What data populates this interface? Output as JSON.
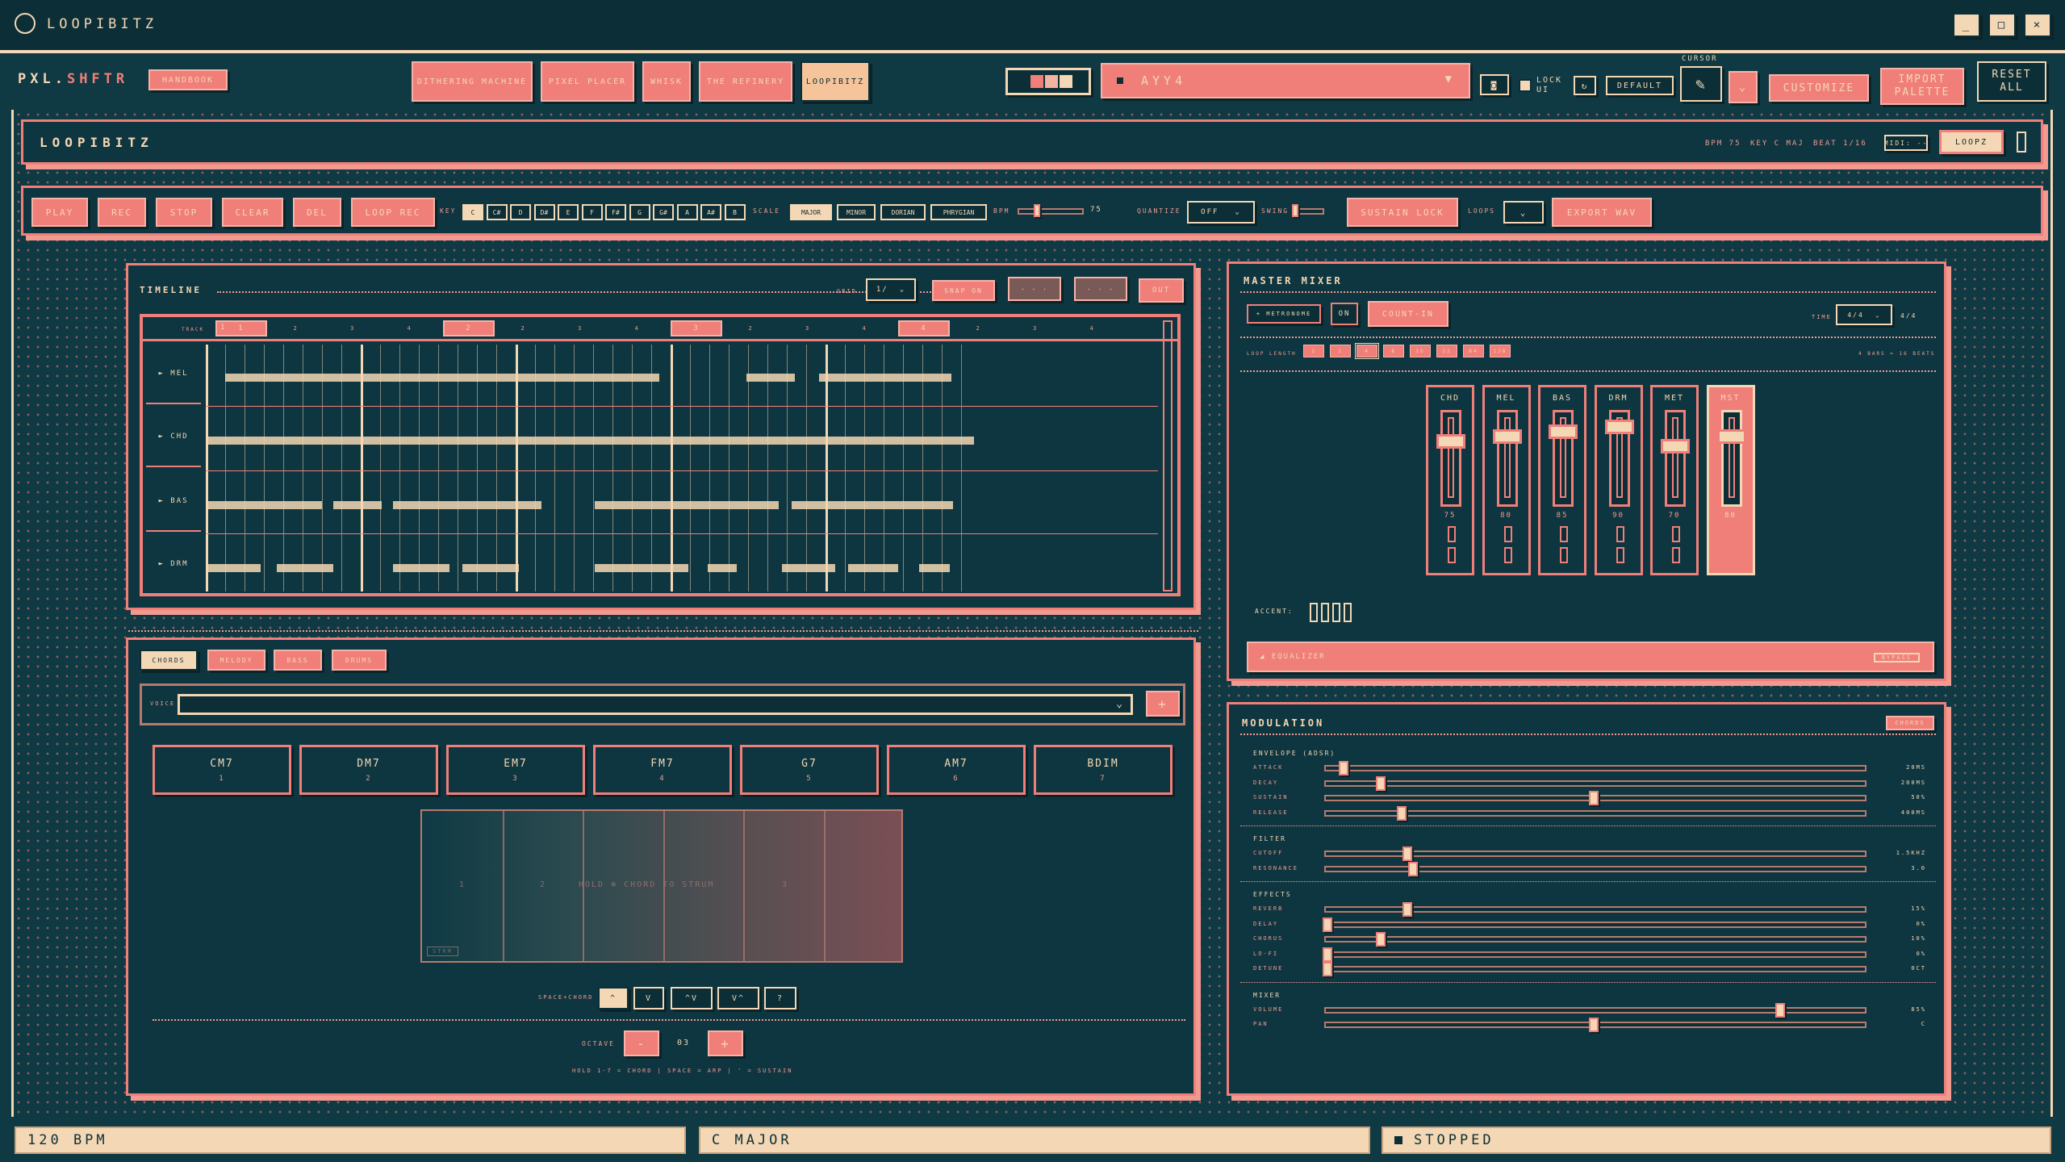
{
  "window": {
    "title": "LOOPIBITZ",
    "min_icon": "minimize-icon",
    "max_icon": "maximize-icon",
    "close_icon": "close-icon"
  },
  "topbar": {
    "brand_a": "PXL.",
    "brand_b": "SHFTR",
    "handbook": "HANDBOOK",
    "tabs": [
      "DITHERING MACHINE",
      "PIXEL PLACER",
      "WHISK",
      "THE REFINERY",
      "LOOPIBITZ"
    ],
    "palette_name": "AYY4",
    "lock_label": "LOCK UI",
    "default": "DEFAULT",
    "cursor_label": "CURSOR",
    "customize": "CUSTOMIZE",
    "import_palette": "IMPORT PALETTE",
    "reset_all": "RESET ALL"
  },
  "header": {
    "title": "LOOPIBITZ",
    "bpm": "BPM 75",
    "key": "KEY C MAJ",
    "beat": "BEAT 1/16",
    "midi": "MIDI: --",
    "loopz": "LOOPZ"
  },
  "transport": {
    "buttons": [
      "PLAY",
      "REC",
      "STOP",
      "CLEAR",
      "DEL",
      "LOOP REC"
    ],
    "key_label": "KEY",
    "keys": [
      "C",
      "C#",
      "D",
      "D#",
      "E",
      "F",
      "F#",
      "G",
      "G#",
      "A",
      "A#",
      "B"
    ],
    "scale_label": "SCALE",
    "scales": [
      "MAJOR",
      "MINOR",
      "DORIAN",
      "PHRYGIAN"
    ],
    "bpm_label": "BPM",
    "bpm_value": "75",
    "quantize_label": "QUANTIZE",
    "quantize_value": "OFF",
    "swing_label": "SWING",
    "sustain_lock": "SUSTAIN LOCK",
    "loops_label": "LOOPS",
    "export": "EXPORT WAV"
  },
  "timeline": {
    "title": "TIMELINE",
    "grid_label": "GRID",
    "grid_value": "1/",
    "snap": "SNAP ON",
    "out": "OUT",
    "track_label": "TRACK",
    "bars": [
      "1",
      "2",
      "3",
      "4"
    ],
    "rows": [
      "► MEL",
      "► CHD",
      "► BAS",
      "► DRM"
    ]
  },
  "instrument": {
    "tabs": [
      "CHORDS",
      "MELODY",
      "BASS",
      "DRUMS"
    ],
    "voice_label": "VOICE",
    "add": "+",
    "chords": [
      {
        "name": "CM7",
        "idx": "1"
      },
      {
        "name": "DM7",
        "idx": "2"
      },
      {
        "name": "EM7",
        "idx": "3"
      },
      {
        "name": "FM7",
        "idx": "4"
      },
      {
        "name": "G7",
        "idx": "5"
      },
      {
        "name": "AM7",
        "idx": "6"
      },
      {
        "name": "BDIM",
        "idx": "7"
      }
    ],
    "pad_nums": [
      "1",
      "2",
      "3"
    ],
    "pad_text": "HOLD ⊕ CHORD TO STRUM",
    "pad_sub": "STRM",
    "space_label": "SPACE+CHORD",
    "inversions": [
      "^",
      "V",
      "^V",
      "V^",
      "?"
    ],
    "octave_label": "OCTAVE",
    "octave_minus": "-",
    "octave_plus": "+",
    "octave_value": "03",
    "hint": "HOLD 1-7 = CHORD | SPACE = ARP | ' = SUSTAIN"
  },
  "mixer": {
    "title": "MASTER MIXER",
    "metronome": "+ METRONOME",
    "on": "ON",
    "countin": "COUNT-IN",
    "time_label": "TIME",
    "time_value": "4/4",
    "time_display": "4/4",
    "loop_length_label": "LOOP LENGTH",
    "loop_lengths": [
      "1",
      "2",
      "4",
      "8",
      "16",
      "32",
      "64",
      "128"
    ],
    "loop_info": "4 BARS = 16 BEATS",
    "strips": [
      {
        "name": "CHD",
        "value": "75",
        "level": 0.75
      },
      {
        "name": "MEL",
        "value": "80",
        "level": 0.8
      },
      {
        "name": "BAS",
        "value": "85",
        "level": 0.85
      },
      {
        "name": "DRM",
        "value": "90",
        "level": 0.9
      },
      {
        "name": "MET",
        "value": "70",
        "level": 0.7
      },
      {
        "name": "MST",
        "value": "80",
        "level": 0.8
      }
    ],
    "accent_label": "ACCENT:",
    "equalizer": "◢ EQUALIZER",
    "bypass": "BYPASS"
  },
  "modulation": {
    "title": "MODULATION",
    "badge": "CHORDS",
    "sections": [
      {
        "title": "ENVELOPE (ADSR)",
        "params": [
          {
            "label": "ATTACK",
            "value": "20MS",
            "level": 0.03
          },
          {
            "label": "DECAY",
            "value": "200MS",
            "level": 0.1
          },
          {
            "label": "SUSTAIN",
            "value": "50%",
            "level": 0.5
          },
          {
            "label": "RELEASE",
            "value": "400MS",
            "level": 0.14
          }
        ]
      },
      {
        "title": "FILTER",
        "params": [
          {
            "label": "CUTOFF",
            "value": "1.5KHZ",
            "level": 0.15
          },
          {
            "label": "RESONANCE",
            "value": "3.0",
            "level": 0.16
          }
        ]
      },
      {
        "title": "EFFECTS",
        "params": [
          {
            "label": "REVERB",
            "value": "15%",
            "level": 0.15
          },
          {
            "label": "DELAY",
            "value": "0%",
            "level": 0.0
          },
          {
            "label": "CHORUS",
            "value": "10%",
            "level": 0.1
          },
          {
            "label": "LO-FI",
            "value": "0%",
            "level": 0.0
          },
          {
            "label": "DETUNE",
            "value": "0CT",
            "level": 0.0
          }
        ]
      },
      {
        "title": "MIXER",
        "params": [
          {
            "label": "VOLUME",
            "value": "85%",
            "level": 0.85
          },
          {
            "label": "PAN",
            "value": "C",
            "level": 0.5
          }
        ]
      }
    ]
  },
  "statusbar": {
    "bpm": "120 BPM",
    "key": "C MAJOR",
    "state": "STOPPED"
  }
}
